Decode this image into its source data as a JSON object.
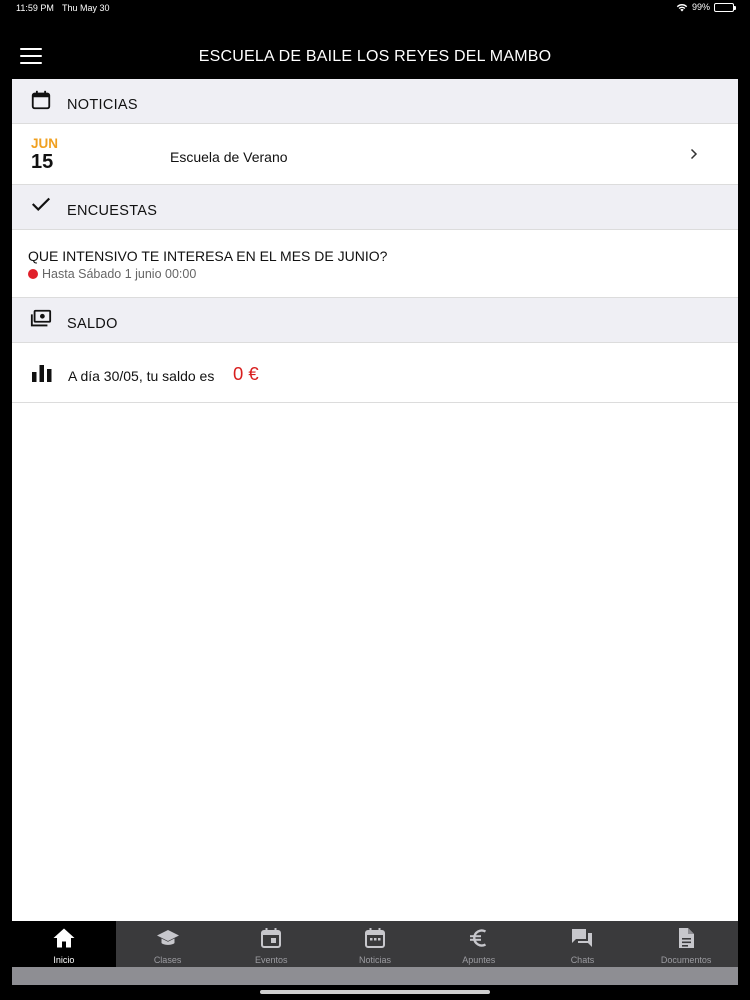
{
  "status": {
    "time": "11:59 PM",
    "date": "Thu May 30",
    "battery": "99%"
  },
  "app": {
    "title": "ESCUELA DE BAILE LOS REYES DEL MAMBO"
  },
  "sections": {
    "news": {
      "title": "NOTICIAS",
      "icon": "calendar-icon",
      "items": [
        {
          "month": "JUN",
          "day": "15",
          "title": "Escuela de Verano"
        }
      ]
    },
    "polls": {
      "title": "ENCUESTAS",
      "icon": "checkmark-icon",
      "items": [
        {
          "question": "QUE INTENSIVO TE INTERESA EN EL MES DE JUNIO?",
          "deadline": "Hasta Sábado 1 junio 00:00"
        }
      ]
    },
    "balance": {
      "title": "SALDO",
      "icon": "money-icon",
      "text": "A día 30/05, tu saldo es",
      "amount": "0 €"
    }
  },
  "tabs": [
    {
      "label": "Inicio",
      "icon": "home-icon",
      "active": true
    },
    {
      "label": "Clases",
      "icon": "graduation-cap-icon",
      "active": false
    },
    {
      "label": "Eventos",
      "icon": "event-calendar-icon",
      "active": false
    },
    {
      "label": "Noticias",
      "icon": "calendar-icon",
      "active": false
    },
    {
      "label": "Apuntes",
      "icon": "euro-icon",
      "active": false
    },
    {
      "label": "Chats",
      "icon": "chat-icon",
      "active": false
    },
    {
      "label": "Documentos",
      "icon": "document-icon",
      "active": false
    }
  ],
  "colors": {
    "accent_month": "#f0a020",
    "balance_red": "#d81e1e",
    "deadline_dot": "#e0202a",
    "tabbar": "#3a3a3c"
  }
}
